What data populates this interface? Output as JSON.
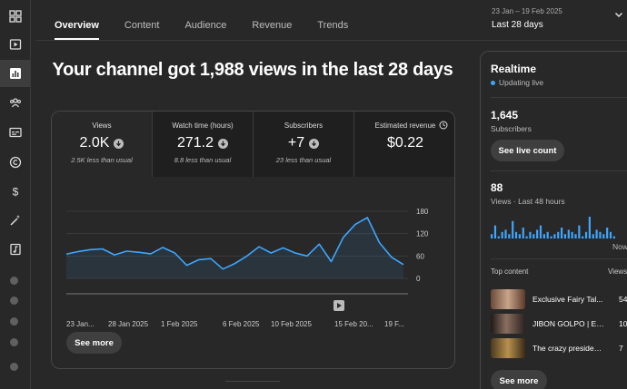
{
  "sidebar": {
    "icons": [
      "dashboard-icon",
      "content-icon",
      "analytics-icon",
      "community-icon",
      "subtitles-icon",
      "copyright-icon",
      "earn-icon",
      "customization-icon",
      "audio-library-icon"
    ]
  },
  "tabs": [
    {
      "label": "Overview",
      "active": true
    },
    {
      "label": "Content",
      "active": false
    },
    {
      "label": "Audience",
      "active": false
    },
    {
      "label": "Revenue",
      "active": false
    },
    {
      "label": "Trends",
      "active": false
    }
  ],
  "date_range": {
    "range": "23 Jan – 19 Feb 2025",
    "label": "Last 28 days"
  },
  "headline": "Your channel got 1,988 views in the last 28 days",
  "metrics": [
    {
      "label": "Views",
      "value": "2.0K",
      "comparison": "2.5K less than usual"
    },
    {
      "label": "Watch time (hours)",
      "value": "271.2",
      "comparison": "8.8 less than usual"
    },
    {
      "label": "Subscribers",
      "value": "+7",
      "comparison": "23 less than usual"
    },
    {
      "label": "Estimated revenue",
      "value": "$0.22",
      "comparison": ""
    }
  ],
  "chart_data": {
    "type": "area",
    "series": [
      {
        "values": [
          65,
          72,
          77,
          79,
          63,
          73,
          70,
          66,
          83,
          68,
          35,
          50,
          53,
          25,
          40,
          60,
          85,
          68,
          82,
          68,
          60,
          92,
          45,
          110,
          145,
          163,
          96,
          57,
          37
        ]
      }
    ],
    "x_tick_labels": [
      "23 Jan...",
      "28 Jan 2025",
      "1 Feb 2025",
      "6 Feb 2025",
      "10 Feb 2025",
      "15 Feb 20...",
      "19 F..."
    ],
    "y_ticks": [
      0,
      60,
      120,
      180
    ],
    "ylim": [
      0,
      180
    ],
    "color": "#3ea6ff"
  },
  "see_more": "See more",
  "realtime": {
    "title": "Realtime",
    "status": "Updating live",
    "subscribers_value": "1,645",
    "subscribers_label": "Subscribers",
    "see_live_count": "See live count",
    "views_value": "88",
    "views_label": "Views · Last 48 hours",
    "bar_values": [
      2,
      6,
      1,
      3,
      4,
      2,
      8,
      3,
      2,
      5,
      1,
      3,
      2,
      4,
      6,
      2,
      3,
      1,
      2,
      3,
      5,
      2,
      4,
      3,
      2,
      6,
      1,
      3,
      10,
      2,
      4,
      3,
      2,
      5,
      3,
      1
    ],
    "now_label": "Now",
    "top_content_label": "Top content",
    "views_col_label": "Views",
    "top_content": [
      {
        "title": "Exclusive Fairy Tal...",
        "views": "54",
        "thumb_color": "#8a6a5a"
      },
      {
        "title": "JIBON GOLPO | Ep...",
        "views": "10",
        "thumb_color": "#3a2e2a"
      },
      {
        "title": "The crazy president...",
        "views": "7",
        "thumb_color": "#6a5630"
      }
    ],
    "see_more": "See more"
  }
}
